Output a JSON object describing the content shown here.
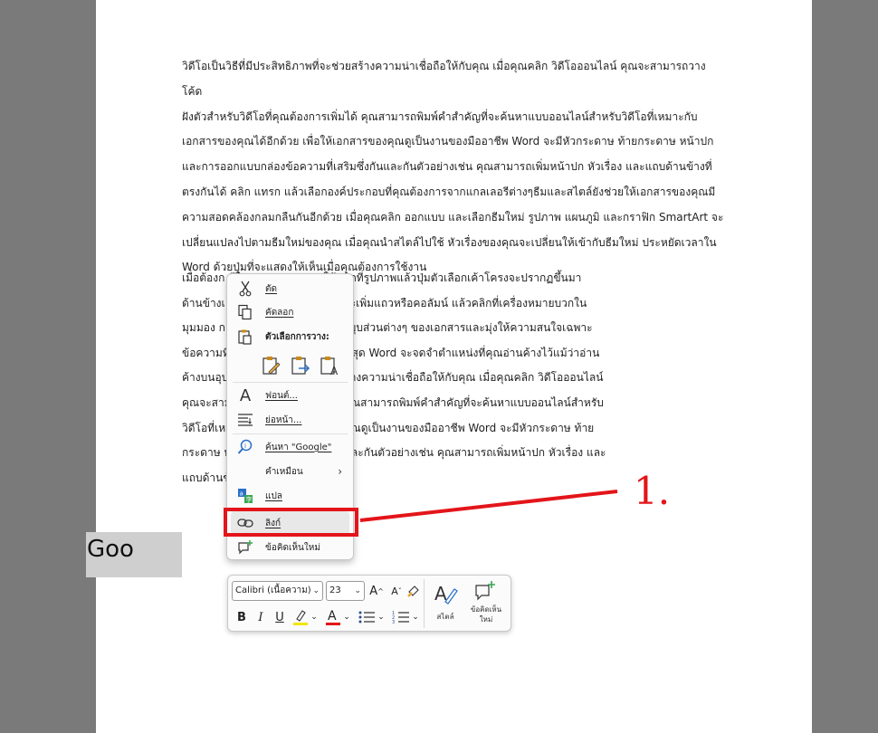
{
  "document": {
    "paragraph_1": "วิดีโอเป็นวิธีที่มีประสิทธิภาพที่จะช่วยสร้างความน่าเชื่อถือให้กับคุณ เมื่อคุณคลิก วิดีโอออนไลน์ คุณจะสามารถวางโค้ด\nฝังตัวสำหรับวิดีโอที่คุณต้องการเพิ่มได้ คุณสามารถพิมพ์คำสำคัญที่จะค้นหาแบบออนไลน์สำหรับวิดีโอที่เหมาะกับ\nเอกสารของคุณได้อีกด้วย เพื่อให้เอกสารของคุณดูเป็นงานของมืออาชีพ Word จะมีหัวกระดาษ ท้ายกระดาษ หน้าปก\nและการออกแบบกล่องข้อความที่เสริมซึ่งกันและกันตัวอย่างเช่น คุณสามารถเพิ่มหน้าปก หัวเรื่อง และแถบด้านข้างที่\nตรงกันได้ คลิก แทรก แล้วเลือกองค์ประกอบที่คุณต้องการจากแกลเลอรีต่างๆธีมและสไตล์ยังช่วยให้เอกสารของคุณมี\nความสอดคล้องกลมกลืนกันอีกด้วย เมื่อคุณคลิก ออกแบบ และเลือกธีมใหม่ รูปภาพ แผนภูมิ และกราฟิก SmartArt จะ\nเปลี่ยนแปลงไปตามธีมใหม่ของคุณ เมื่อคุณนำสไตล์ไปใช้ หัวเรื่องของคุณจะเปลี่ยนให้เข้ากับธีมใหม่ ประหยัดเวลาใน\nWord ด้วยปุ่มที่จะแสดงให้เห็นเมื่อคุณต้องการใช้งาน",
    "paragraph_2": "เมื่อต้องก                                 ดีในเอกสารของคุณ ให้คลิกที่รูปภาพแล้วปุ่มตัวเลือกเค้าโครงจะปรากฏขึ้นมา\nด้านข้างเ                                 ลิกตำแหน่งที่คุณต้องการจะเพิ่มแถวหรือคอลัมน์ แล้วคลิกที่เครื่องหมายบวกใน\nมุมมอง ก                                  ง่ายขึ้นอีกด้วยคุณสามารถยุบส่วนต่างๆ ของเอกสารและมุ่งให้ความสนใจเฉพาะ\nข้อความที่                                 ะหยุดอ่านก่อนจะถึงจุดสิ้นสุด Word จะจดจำตำแหน่งที่คุณอ่านค้างไว้แม้ว่าอ่าน\nค้างบนอุป                                  มีประสิทธิภาพที่จะช่วยสร้างความน่าเชื่อถือให้กับคุณ เมื่อคุณคลิก วิดีโอออนไลน์\nคุณจะสาม                                  โอที่คุณต้องการเพิ่มได้ คุณสามารถพิมพ์คำสำคัญที่จะค้นหาแบบออนไลน์สำหรับ\nวิดีโอที่เหม                                  ด้วย เพื่อให้เอกสารของคุณดูเป็นงานของมืออาชีพ Word จะมีหัวกระดาษ ท้าย\nกระดาษ ห                                 องข้อความที่เสริมซึ่งกันและกันตัวอย่างเช่น คุณสามารถเพิ่มหน้าปก หัวเรื่อง และ\nแถบด้านข้",
    "selected_word": "Goo"
  },
  "context_menu": {
    "cut": "ตัด",
    "copy": "คัดลอก",
    "paste_options": "ตัวเลือกการวาง:",
    "font": "ฟอนต์...",
    "paragraph": "ย่อหน้า...",
    "search": "ค้นหา \"Google\"",
    "synonyms": "คำเหมือน",
    "translate": "แปล",
    "link": "ลิงก์",
    "new_comment": "ข้อคิดเห็นใหม่"
  },
  "annotation": {
    "number": "1.",
    "color": "#e3151a"
  },
  "mini_toolbar": {
    "font_name": "Calibri (เนื้อความ)",
    "font_size": "23",
    "bold": "B",
    "italic": "I",
    "underline": "U",
    "styles_label": "สไตล์",
    "new_comment_label_1": "ข้อคิดเห็น",
    "new_comment_label_2": "ใหม่",
    "highlight_color": "#f2e600",
    "font_color": "#e3151a"
  }
}
